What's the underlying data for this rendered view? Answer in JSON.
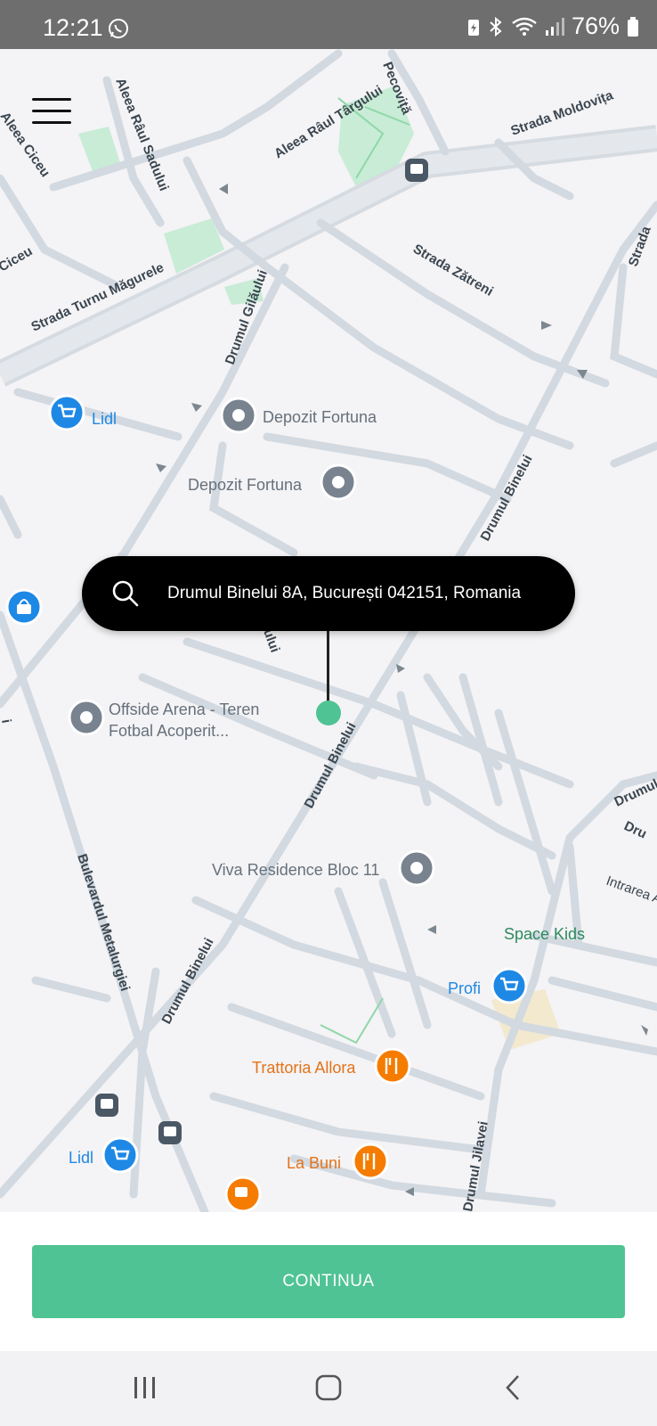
{
  "status_bar": {
    "time": "12:21",
    "battery": "76%"
  },
  "map": {
    "streets": [
      "Strada Turnu Măgurele",
      "Aleea Râul Târgului",
      "Aleea Râul Sadului",
      "Strada Moldovița",
      "Strada Zătreni",
      "Drumul Gilăului",
      "Drumul Binelui",
      "Bulevardul Metalurgiei",
      "Drumul Jilavei",
      "Intrarea A",
      "Ciceu",
      "Drumul",
      "Dru",
      "Strada",
      "Aleea Ciceu",
      "Pecoviță",
      "ului",
      "i"
    ],
    "pois": {
      "lidl_top": "Lidl",
      "depozit_1": "Depozit Fortuna",
      "depozit_2": "Depozit Fortuna",
      "offside_1": "Offside Arena - Teren",
      "offside_2": "Fotbal Acoperit...",
      "viva": "Viva Residence Bloc 11",
      "space_kids": "Space Kids",
      "profi": "Profi",
      "trattoria": "Trattoria Allora",
      "la_buni": "La Buni",
      "lidl_bottom": "Lidl"
    },
    "colors": {
      "pin_green": "#4fc393",
      "shop_blue": "#1e88e5",
      "food_orange": "#f57c00",
      "poi_gray": "#78838f",
      "park_green": "#c8ecd6"
    }
  },
  "search": {
    "address": "Drumul Binelui 8A, București 042151, Romania"
  },
  "action": {
    "continue_label": "CONTINUA"
  }
}
